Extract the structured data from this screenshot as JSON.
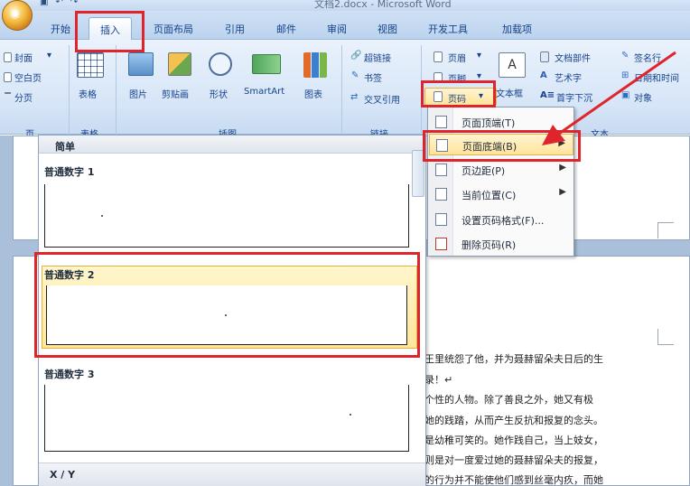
{
  "window": {
    "title": "文档2.docx - Microsoft Word"
  },
  "tabs": [
    "开始",
    "插入",
    "页面布局",
    "引用",
    "邮件",
    "审阅",
    "视图",
    "开发工具",
    "加载项"
  ],
  "active_tab": "插入",
  "ribbon": {
    "pages_group": {
      "items": [
        "封面",
        "空白页",
        "分页"
      ],
      "label": "页"
    },
    "tables_group": {
      "button": "表格",
      "label": "表格"
    },
    "illustrations_group": {
      "buttons": [
        "图片",
        "剪贴画",
        "形状",
        "SmartArt",
        "图表"
      ],
      "label": "插图"
    },
    "links_group": {
      "items": [
        "超链接",
        "书签",
        "交叉引用"
      ],
      "label": "链接"
    },
    "header_footer_group": {
      "items": [
        "页眉",
        "页脚",
        "页码"
      ]
    },
    "text_group": {
      "textbox": "文本框",
      "items": [
        "文档部件",
        "艺术字",
        "首字下沉",
        "签名行",
        "日期和时间",
        "对象"
      ],
      "label": "文本"
    }
  },
  "gallery": {
    "header": "简单",
    "items": [
      "普通数字 1",
      "普通数字 2",
      "普通数字 3"
    ],
    "footer": "X / Y",
    "selected": "普通数字 2"
  },
  "page_number_menu": {
    "items": [
      {
        "label": "页面顶端(T)",
        "submenu": false
      },
      {
        "label": "页面底端(B)",
        "submenu": true
      },
      {
        "label": "页边距(P)",
        "submenu": true
      },
      {
        "label": "当前位置(C)",
        "submenu": true
      },
      {
        "label": "设置页码格式(F)...",
        "submenu": false
      },
      {
        "label": "删除页码(R)",
        "submenu": false
      }
    ],
    "highlighted": "页面底端(B)"
  },
  "document": {
    "lines": [
      "王里统怨了他，并为聂赫留朵夫日后的生",
      "录！↵",
      "个性的人物。除了善良之外，她又有极",
      "她的践踏，从而产生反抗和报复的念头。",
      "是幼稚可笑的。她作践自己，当上妓女，",
      "则是对一度爱过她的聂赫留朵夫的报复，",
      "的行为并不能使他们感到丝毫内疚，而她"
    ]
  },
  "colors": {
    "annotation_red": "#e0242b",
    "highlight_yellow": "#ffe39a"
  }
}
